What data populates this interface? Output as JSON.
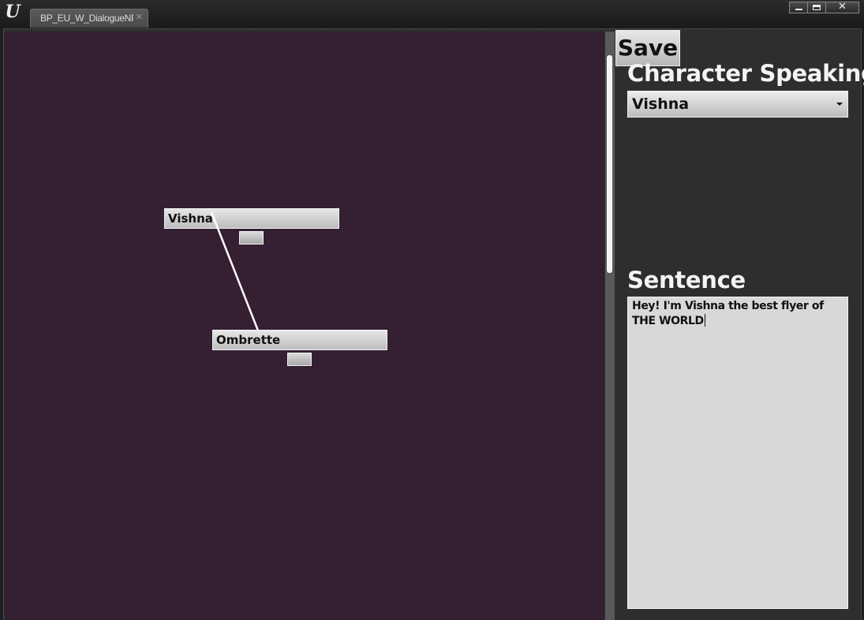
{
  "window": {
    "logo_icon": "unreal-engine-logo",
    "tab_title": "BP_EU_W_DialogueNF",
    "tab_close_icon": "close-icon",
    "controls": [
      "minimize-icon",
      "maximize-icon",
      "close-icon"
    ]
  },
  "graph": {
    "background_color": "#341f33",
    "nodes": [
      {
        "id": "node-vishna",
        "label": "Vishna"
      },
      {
        "id": "node-ombrette",
        "label": "Ombrette"
      }
    ],
    "connections": [
      {
        "from": "Vishna",
        "to": "Ombrette"
      }
    ]
  },
  "panel": {
    "save_label": "Save",
    "character_heading": "Character Speaking",
    "character_selected": "Vishna",
    "sentence_heading": "Sentence",
    "sentence_text": "Hey! I'm Vishna the best flyer of THE WORLD"
  }
}
